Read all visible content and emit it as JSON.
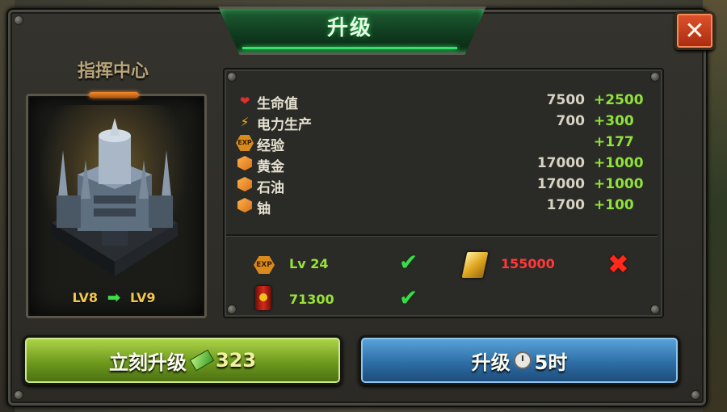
{
  "dialog": {
    "title": "升级",
    "close_glyph": "✕"
  },
  "building": {
    "name": "指挥中心",
    "level_from": "LV8",
    "level_to": "LV9",
    "arrow_glyph": "➡"
  },
  "stats": [
    {
      "icon": "heart-icon",
      "glyph": "❤",
      "label": "生命值",
      "value": "7500",
      "increase": "+2500"
    },
    {
      "icon": "lightning-icon",
      "glyph": "⚡",
      "label": "电力生产",
      "value": "700",
      "increase": "+300"
    },
    {
      "icon": "exp-icon",
      "glyph": "EXP",
      "label": "经验",
      "value": "",
      "increase": "+177"
    },
    {
      "icon": "gold-resource-icon",
      "glyph": "",
      "label": "黄金",
      "value": "17000",
      "increase": "+1000"
    },
    {
      "icon": "oil-resource-icon",
      "glyph": "",
      "label": "石油",
      "value": "17000",
      "increase": "+1000"
    },
    {
      "icon": "uranium-resource-icon",
      "glyph": "",
      "label": "铀",
      "value": "1700",
      "increase": "+100"
    }
  ],
  "requirements": {
    "exp_glyph": "EXP",
    "level": "Lv 24",
    "level_met": "✔",
    "gold": "155000",
    "gold_not_met": "✖",
    "oil": "71300",
    "oil_met": "✔"
  },
  "buttons": {
    "instant_label": "立刻升级",
    "instant_cost": "323",
    "upgrade_label": "升级",
    "upgrade_time": "5时"
  },
  "colors": {
    "accent_green": "#3ddc4a",
    "warning_red": "#ff3a3a",
    "panel": "#2b2a25"
  }
}
